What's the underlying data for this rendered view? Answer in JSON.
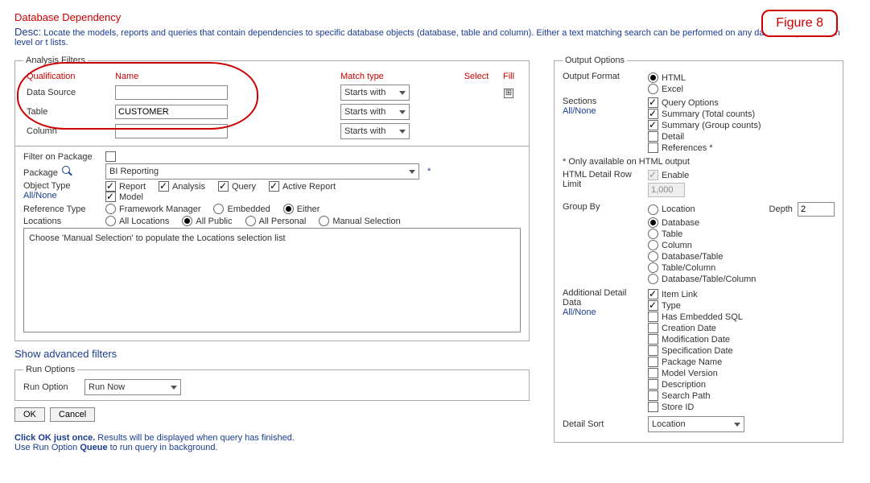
{
  "figure_label": "Figure 8",
  "title": "Database Dependency",
  "desc_label": "Desc:",
  "desc_text": "Locate the models, reports and queries that contain dependencies to specific database objects (database, table and column). Either a text matching search can be performed on any database qualification level or t lists.",
  "analysis_filters": {
    "legend": "Analysis Filters",
    "headers": {
      "qualification": "Qualification",
      "name": "Name",
      "match": "Match type",
      "select": "Select",
      "fill": "Fill"
    },
    "rows": [
      {
        "label": "Data Source",
        "value": "",
        "match": "Starts with"
      },
      {
        "label": "Table",
        "value": "CUSTOMER",
        "match": "Starts with"
      },
      {
        "label": "Column",
        "value": "",
        "match": "Starts with"
      }
    ],
    "filter_on_package": {
      "label": "Filter on Package",
      "checked": false
    },
    "package": {
      "label": "Package",
      "value": "BI Reporting"
    },
    "object_type": {
      "label": "Object Type",
      "allnone": "All/None",
      "options": [
        {
          "label": "Report",
          "checked": true
        },
        {
          "label": "Analysis",
          "checked": true
        },
        {
          "label": "Query",
          "checked": true
        },
        {
          "label": "Active Report",
          "checked": true
        },
        {
          "label": "Model",
          "checked": true
        }
      ]
    },
    "reference_type": {
      "label": "Reference Type",
      "options": [
        {
          "label": "Framework Manager",
          "checked": false
        },
        {
          "label": "Embedded",
          "checked": false
        },
        {
          "label": "Either",
          "checked": true
        }
      ]
    },
    "locations": {
      "label": "Locations",
      "options": [
        {
          "label": "All Locations",
          "checked": false
        },
        {
          "label": "All Public",
          "checked": true
        },
        {
          "label": "All Personal",
          "checked": false
        },
        {
          "label": "Manual Selection",
          "checked": false
        }
      ]
    },
    "manual_text": "Choose 'Manual Selection' to populate the Locations selection list"
  },
  "show_adv": "Show advanced filters",
  "run_options": {
    "legend": "Run Options",
    "label": "Run Option",
    "value": "Run Now"
  },
  "buttons": {
    "ok": "OK",
    "cancel": "Cancel"
  },
  "footer1a": "Click OK just once.",
  "footer1b": " Results will be displayed when query has finished.",
  "footer2a": "Use Run Option ",
  "footer2b": "Queue",
  "footer2c": " to run query in background.",
  "output_options": {
    "legend": "Output Options",
    "output_format": {
      "label": "Output Format",
      "options": [
        {
          "label": "HTML",
          "checked": true
        },
        {
          "label": "Excel",
          "checked": false
        }
      ]
    },
    "sections": {
      "label": "Sections",
      "allnone": "All/None",
      "options": [
        {
          "label": "Query Options",
          "checked": true
        },
        {
          "label": "Summary (Total counts)",
          "checked": true
        },
        {
          "label": "Summary (Group counts)",
          "checked": true
        },
        {
          "label": "Detail",
          "checked": false
        },
        {
          "label": "References *",
          "checked": false
        }
      ]
    },
    "only_html": "* Only available on HTML output",
    "row_limit": {
      "label": "HTML Detail Row Limit",
      "enable": "Enable",
      "value": "1,000"
    },
    "group_by": {
      "label": "Group By",
      "depth_label": "Depth",
      "depth_value": "2",
      "options": [
        {
          "label": "Location",
          "checked": false
        },
        {
          "label": "Database",
          "checked": true
        },
        {
          "label": "Table",
          "checked": false
        },
        {
          "label": "Column",
          "checked": false
        },
        {
          "label": "Database/Table",
          "checked": false
        },
        {
          "label": "Table/Column",
          "checked": false
        },
        {
          "label": "Database/Table/Column",
          "checked": false
        }
      ]
    },
    "additional": {
      "label": "Additional Detail Data",
      "allnone": "All/None",
      "options": [
        {
          "label": "Item Link",
          "checked": true
        },
        {
          "label": "Type",
          "checked": true
        },
        {
          "label": "Has Embedded SQL",
          "checked": false
        },
        {
          "label": "Creation Date",
          "checked": false
        },
        {
          "label": "Modification Date",
          "checked": false
        },
        {
          "label": "Specification Date",
          "checked": false
        },
        {
          "label": "Package Name",
          "checked": false
        },
        {
          "label": "Model Version",
          "checked": false
        },
        {
          "label": "Description",
          "checked": false
        },
        {
          "label": "Search Path",
          "checked": false
        },
        {
          "label": "Store ID",
          "checked": false
        }
      ]
    },
    "detail_sort": {
      "label": "Detail Sort",
      "value": "Location"
    }
  }
}
